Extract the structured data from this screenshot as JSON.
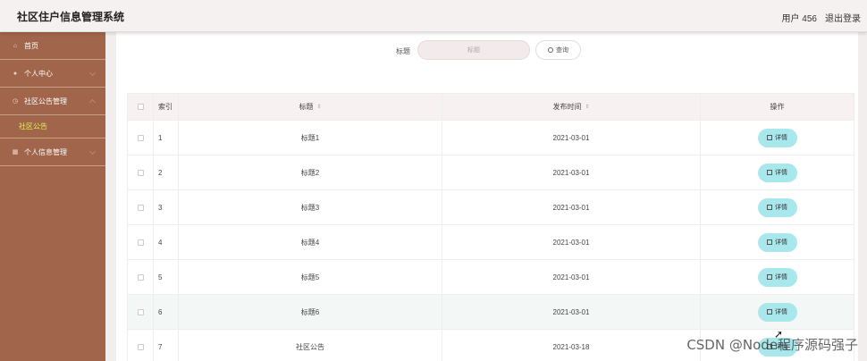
{
  "header": {
    "title": "社区住户信息管理系统",
    "user": "用户 456",
    "logout": "退出登录"
  },
  "sidebar": {
    "items": [
      {
        "label": "首页",
        "icon": "home-icon"
      },
      {
        "label": "个人中心",
        "icon": "user-icon"
      },
      {
        "label": "社区公告管理",
        "icon": "clock-icon"
      },
      {
        "label": "个人信息管理",
        "icon": "folder-icon"
      }
    ],
    "submenu": {
      "label": "社区公告"
    }
  },
  "search": {
    "label": "标题",
    "placeholder": "标题",
    "button": "查询"
  },
  "table": {
    "columns": [
      "索引",
      "标题",
      "发布时间",
      "操作"
    ],
    "rows": [
      {
        "index": "1",
        "title": "标题1",
        "date": "2021-03-01",
        "action": "详情"
      },
      {
        "index": "2",
        "title": "标题2",
        "date": "2021-03-01",
        "action": "详情"
      },
      {
        "index": "3",
        "title": "标题3",
        "date": "2021-03-01",
        "action": "详情"
      },
      {
        "index": "4",
        "title": "标题4",
        "date": "2021-03-01",
        "action": "详情"
      },
      {
        "index": "5",
        "title": "标题5",
        "date": "2021-03-01",
        "action": "详情"
      },
      {
        "index": "6",
        "title": "标题6",
        "date": "2021-03-01",
        "action": "详情"
      },
      {
        "index": "7",
        "title": "社区公告",
        "date": "2021-03-18",
        "action": "详情"
      }
    ]
  },
  "watermark": "CSDN @Node程序源码强子",
  "colors": {
    "sidebar_bg": "#a0654b",
    "submenu_active": "#e2ef58",
    "detail_button": "#a8e8ec",
    "header_bg": "#f6f1f1"
  }
}
